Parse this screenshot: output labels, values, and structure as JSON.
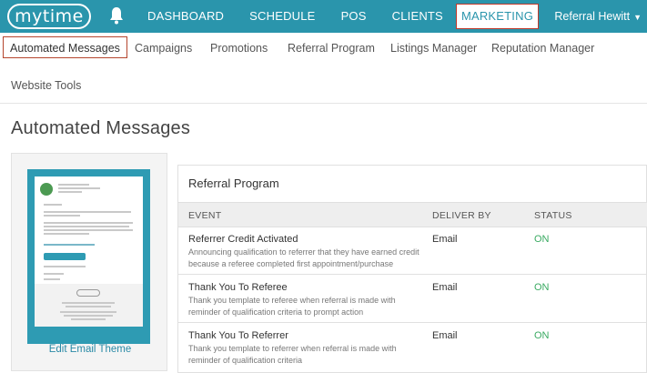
{
  "header": {
    "logo_text": "mytime",
    "nav": [
      {
        "label": "DASHBOARD"
      },
      {
        "label": "SCHEDULE"
      },
      {
        "label": "POS"
      },
      {
        "label": "CLIENTS"
      },
      {
        "label": "MARKETING",
        "active": true
      }
    ],
    "user_name": "Referral Hewitt"
  },
  "subnav": {
    "items": [
      {
        "label": "Automated Messages",
        "active": true
      },
      {
        "label": "Campaigns"
      },
      {
        "label": "Promotions"
      },
      {
        "label": "Referral Program"
      },
      {
        "label": "Listings Manager"
      },
      {
        "label": "Reputation Manager"
      },
      {
        "label": "Website Tools"
      }
    ]
  },
  "page": {
    "title": "Automated Messages"
  },
  "theme": {
    "edit_label": "Edit Email Theme"
  },
  "referral": {
    "title": "Referral Program",
    "columns": {
      "event": "EVENT",
      "deliver_by": "DELIVER BY",
      "status": "STATUS"
    },
    "rows": [
      {
        "name": "Referrer Credit Activated",
        "description": "Announcing qualification to referrer that they have earned credit because a referee completed first appointment/purchase",
        "deliver_by": "Email",
        "status": "ON"
      },
      {
        "name": "Thank You To Referee",
        "description": "Thank you template to referee when referral is made with reminder of qualification criteria to prompt action",
        "deliver_by": "Email",
        "status": "ON"
      },
      {
        "name": "Thank You To Referrer",
        "description": "Thank you template to referrer when referral is made with reminder of qualification criteria",
        "deliver_by": "Email",
        "status": "ON"
      }
    ]
  },
  "colors": {
    "brand": "#2a95ac",
    "status_on": "#3aaa62",
    "highlight_border": "#c0392b"
  },
  "icons": {
    "bell": "bell-icon",
    "caret": "caret-down-icon"
  }
}
